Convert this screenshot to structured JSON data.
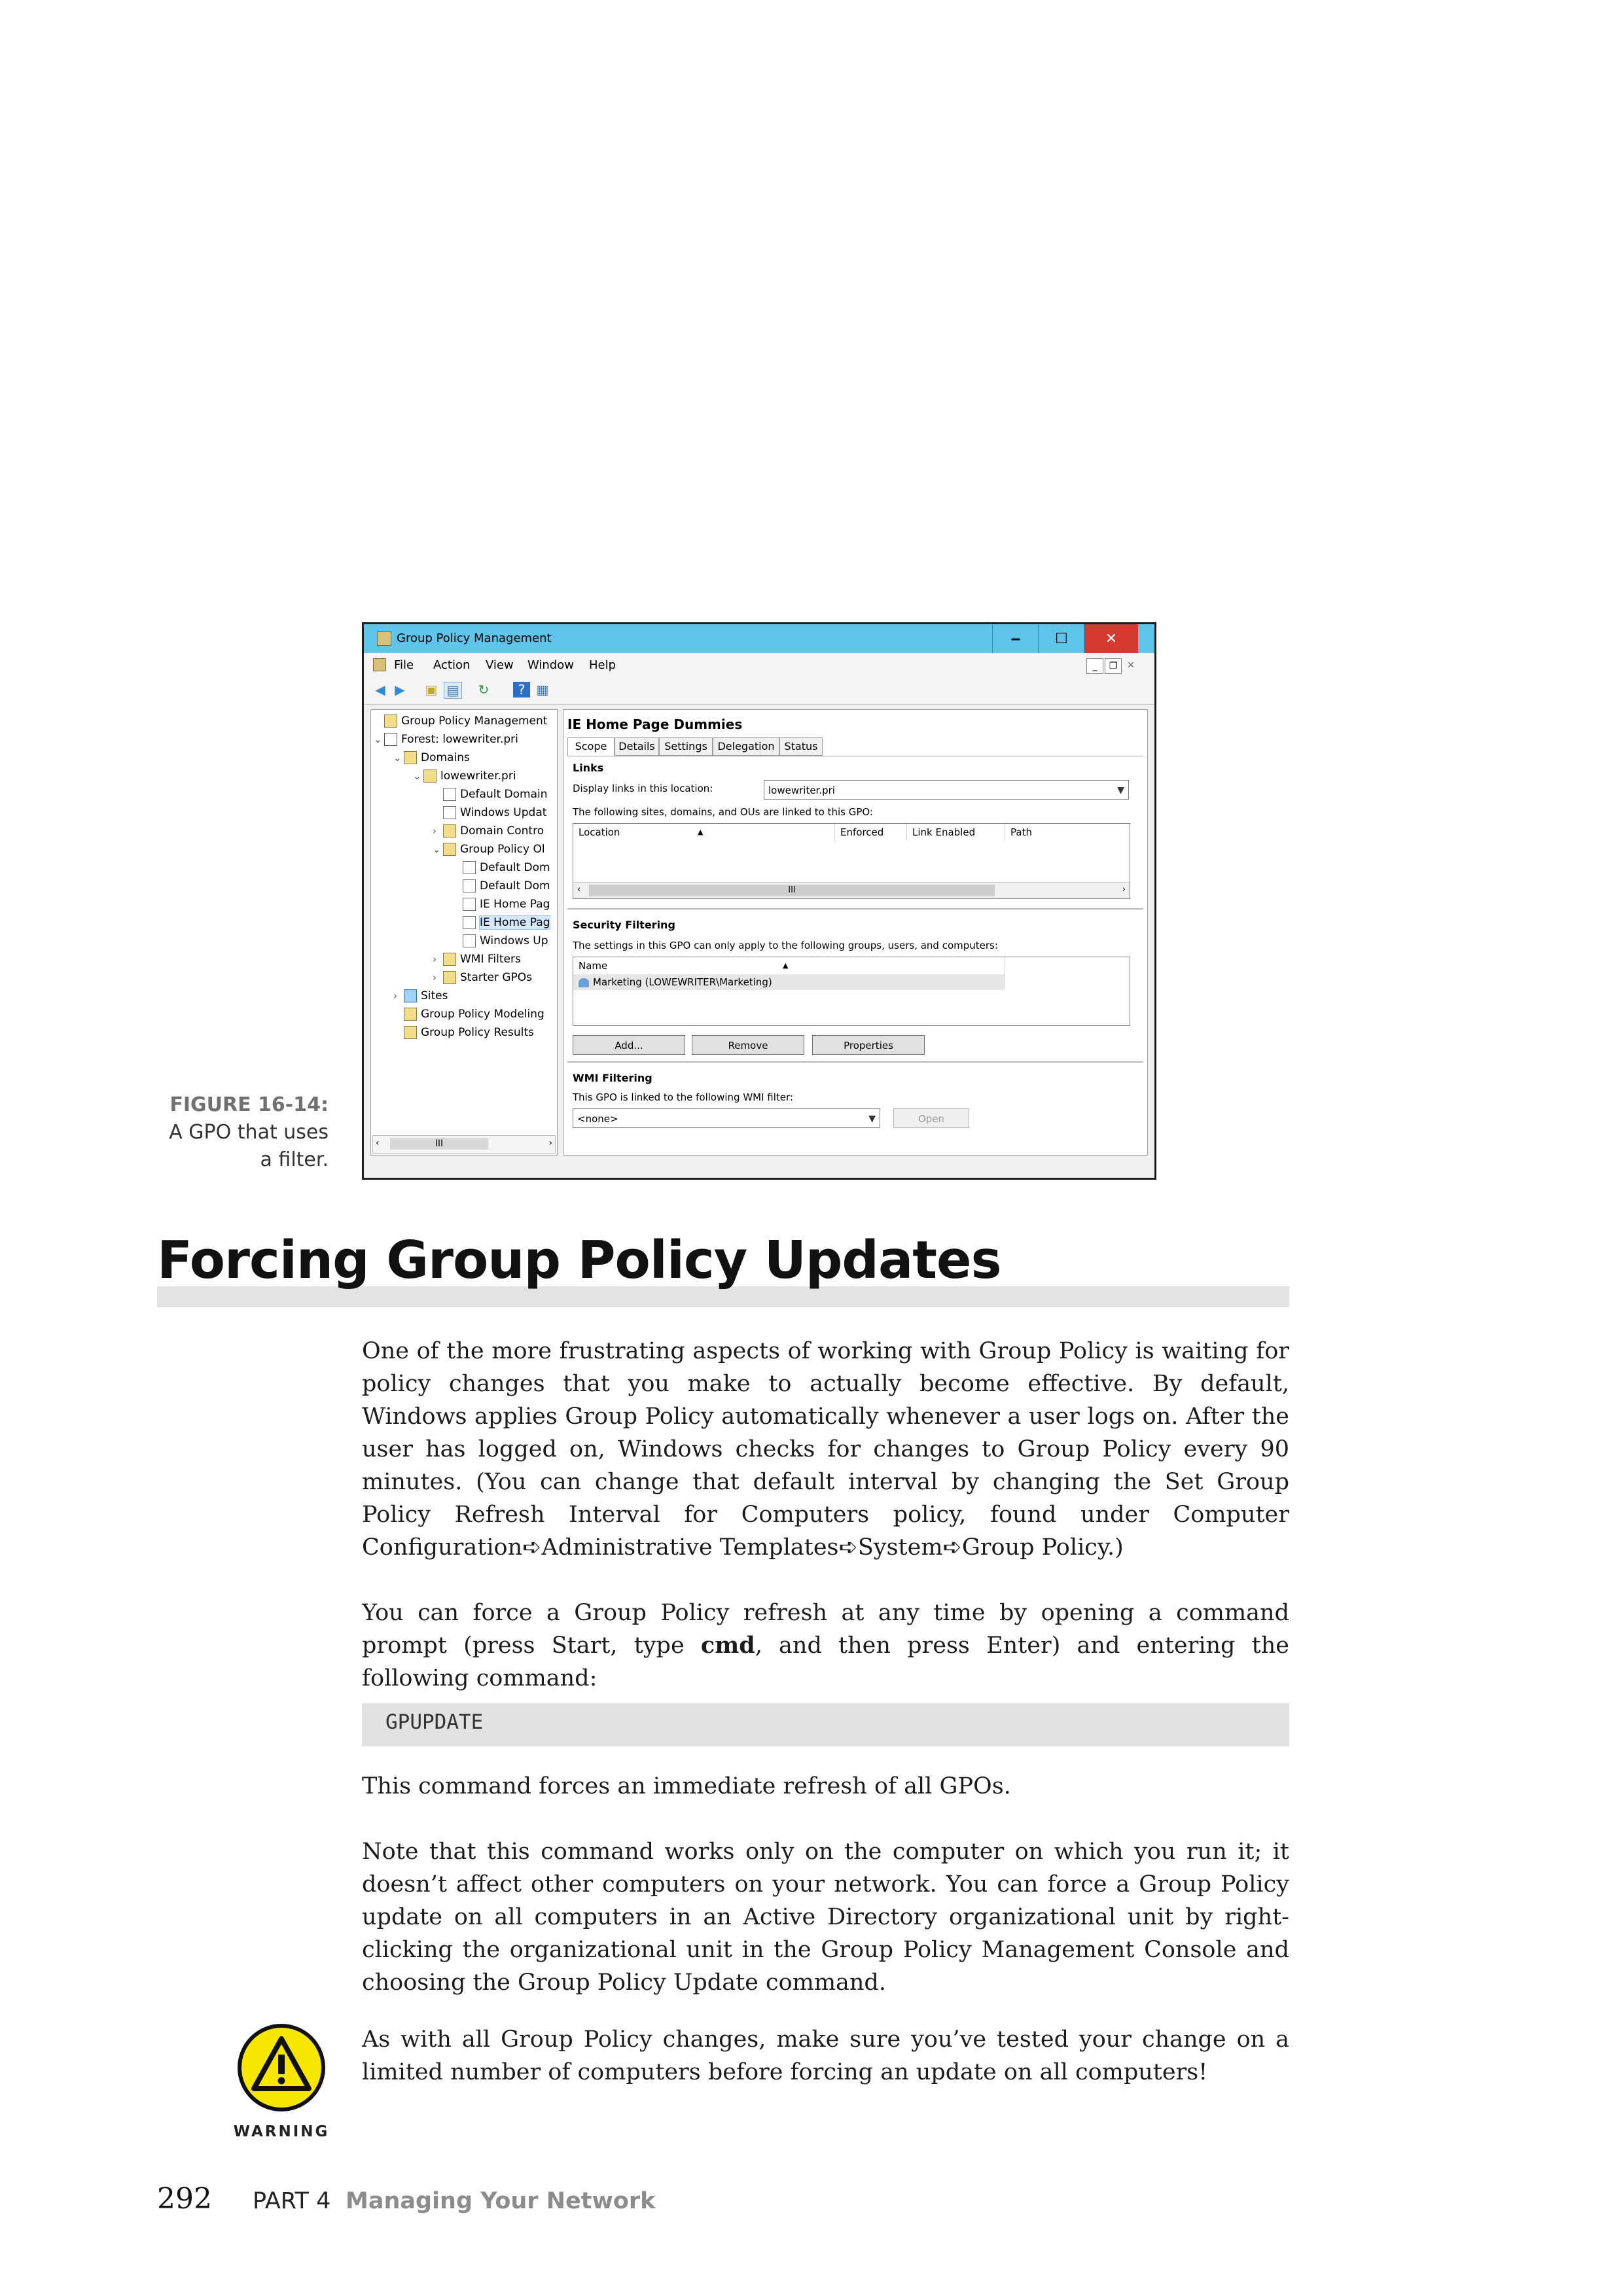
{
  "figure": {
    "label": "FIGURE 16-14:",
    "caption": "A GPO that uses a filter.",
    "window": {
      "title": "Group Policy Management",
      "min_label": "‒",
      "max_label": "☐",
      "close_label": "✕",
      "menu": [
        "File",
        "Action",
        "View",
        "Window",
        "Help"
      ],
      "tree": [
        {
          "label": "Group Policy Management",
          "expander": ""
        },
        {
          "label": "Forest: lowewriter.pri",
          "expander": "⌄"
        },
        {
          "label": "Domains",
          "expander": "⌄"
        },
        {
          "label": "lowewriter.pri",
          "expander": "⌄"
        },
        {
          "label": "Default Domain",
          "expander": ""
        },
        {
          "label": "Windows Updat",
          "expander": ""
        },
        {
          "label": "Domain Contro",
          "expander": "›"
        },
        {
          "label": "Group Policy Ol",
          "expander": "⌄"
        },
        {
          "label": "Default Dom",
          "expander": ""
        },
        {
          "label": "Default Dom",
          "expander": ""
        },
        {
          "label": "IE Home Pag",
          "expander": ""
        },
        {
          "label": "IE Home Pag",
          "expander": ""
        },
        {
          "label": "Windows Up",
          "expander": ""
        },
        {
          "label": "WMI Filters",
          "expander": "›"
        },
        {
          "label": "Starter GPOs",
          "expander": "›"
        },
        {
          "label": "Sites",
          "expander": "›"
        },
        {
          "label": "Group Policy Modeling",
          "expander": ""
        },
        {
          "label": "Group Policy Results",
          "expander": ""
        }
      ],
      "tree_scroll_label": "III",
      "gpo_name": "IE Home Page Dummies",
      "tabs": [
        "Scope",
        "Details",
        "Settings",
        "Delegation",
        "Status"
      ],
      "links": {
        "title": "Links",
        "display_label": "Display links in this location:",
        "location_value": "lowewriter.pri",
        "linked_text": "The following sites, domains, and OUs are linked to this GPO:",
        "columns": [
          "Location",
          "Enforced",
          "Link Enabled",
          "Path"
        ],
        "scroll_label": "III"
      },
      "security": {
        "title": "Security Filtering",
        "description": "The settings in this GPO can only apply to the following groups, users, and computers:",
        "column": "Name",
        "entries": [
          "Marketing (LOWEWRITER\\Marketing)"
        ],
        "buttons": [
          "Add...",
          "Remove",
          "Properties"
        ]
      },
      "wmi": {
        "title": "WMI Filtering",
        "description": "This GPO is linked to the following WMI filter:",
        "filter_value": "<none>",
        "open_button": "Open"
      }
    }
  },
  "section": {
    "heading": "Forcing Group Policy Updates",
    "p1": "One of the more frustrating aspects of working with Group Policy is waiting for policy changes that you make to actually become effective. By default, Windows applies Group Policy automatically whenever a user logs on. After the user has logged on, Windows checks for changes to Group Policy every 90 minutes. (You can change that default interval by changing the Set Group Policy Refresh Interval for Computers policy, found under Computer Configuration➪Administrative Templates➪System➪Group Policy.)",
    "p2_before": "You can force a Group Policy refresh at any time by opening a command prompt (press Start, type ",
    "p2_cmd": "cmd",
    "p2_after": ", and then press Enter) and entering the following command:",
    "code": "GPUPDATE",
    "p3": "This command forces an immediate refresh of all GPOs.",
    "p4": "Note that this command works only on the computer on which you run it; it doesn’t affect other computers on your network. You can force a Group Policy update on all computers in an Active Directory organizational unit by right-clicking the organizational unit in the Group Policy Management Console and choosing the Group Policy Update command.",
    "warning_label": "WARNING",
    "warning_text": "As with all Group Policy changes, make sure you’ve tested your change on a limited number of computers before forcing an update on all computers!"
  },
  "footer": {
    "page_number": "292",
    "part": "PART 4",
    "part_title": "Managing Your Network"
  },
  "colors": {
    "titlebar": "#5fc4ea",
    "close_button": "#d43a2f",
    "heading_bar": "#e3e3e3",
    "warning_yellow": "#f7e600",
    "footer_title": "#8c8c8c"
  }
}
